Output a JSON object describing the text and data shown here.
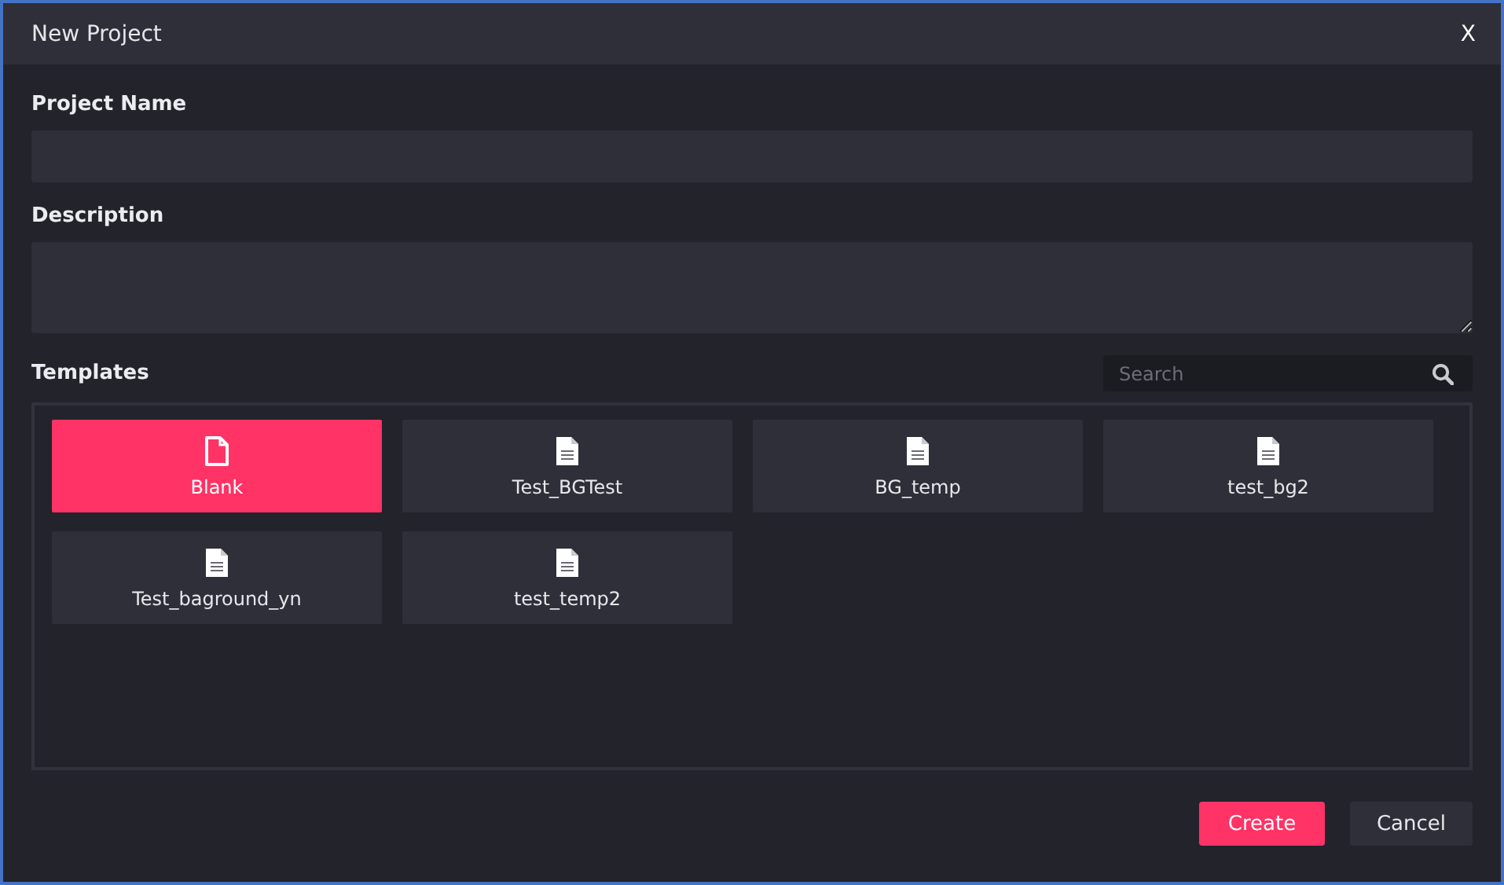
{
  "window": {
    "title": "New Project",
    "close": "X"
  },
  "fields": [
    {
      "label": "Project Name",
      "kind": "input"
    },
    {
      "label": "Description",
      "kind": "textarea"
    }
  ],
  "templates": {
    "label": "Templates",
    "search": {
      "placeholder": "Search"
    },
    "items": [
      {
        "name": "Blank",
        "kind": "blank",
        "selected": true
      },
      {
        "name": "Test_BGTest",
        "kind": "document",
        "selected": false
      },
      {
        "name": "BG_temp",
        "kind": "document",
        "selected": false
      },
      {
        "name": "test_bg2",
        "kind": "document",
        "selected": false
      },
      {
        "name": "Test_baground_yn",
        "kind": "document",
        "selected": false
      },
      {
        "name": "test_temp2",
        "kind": "document",
        "selected": false
      }
    ]
  },
  "buttons": [
    {
      "label": "Create",
      "kind": "primary"
    },
    {
      "label": "Cancel",
      "kind": "secondary"
    }
  ]
}
